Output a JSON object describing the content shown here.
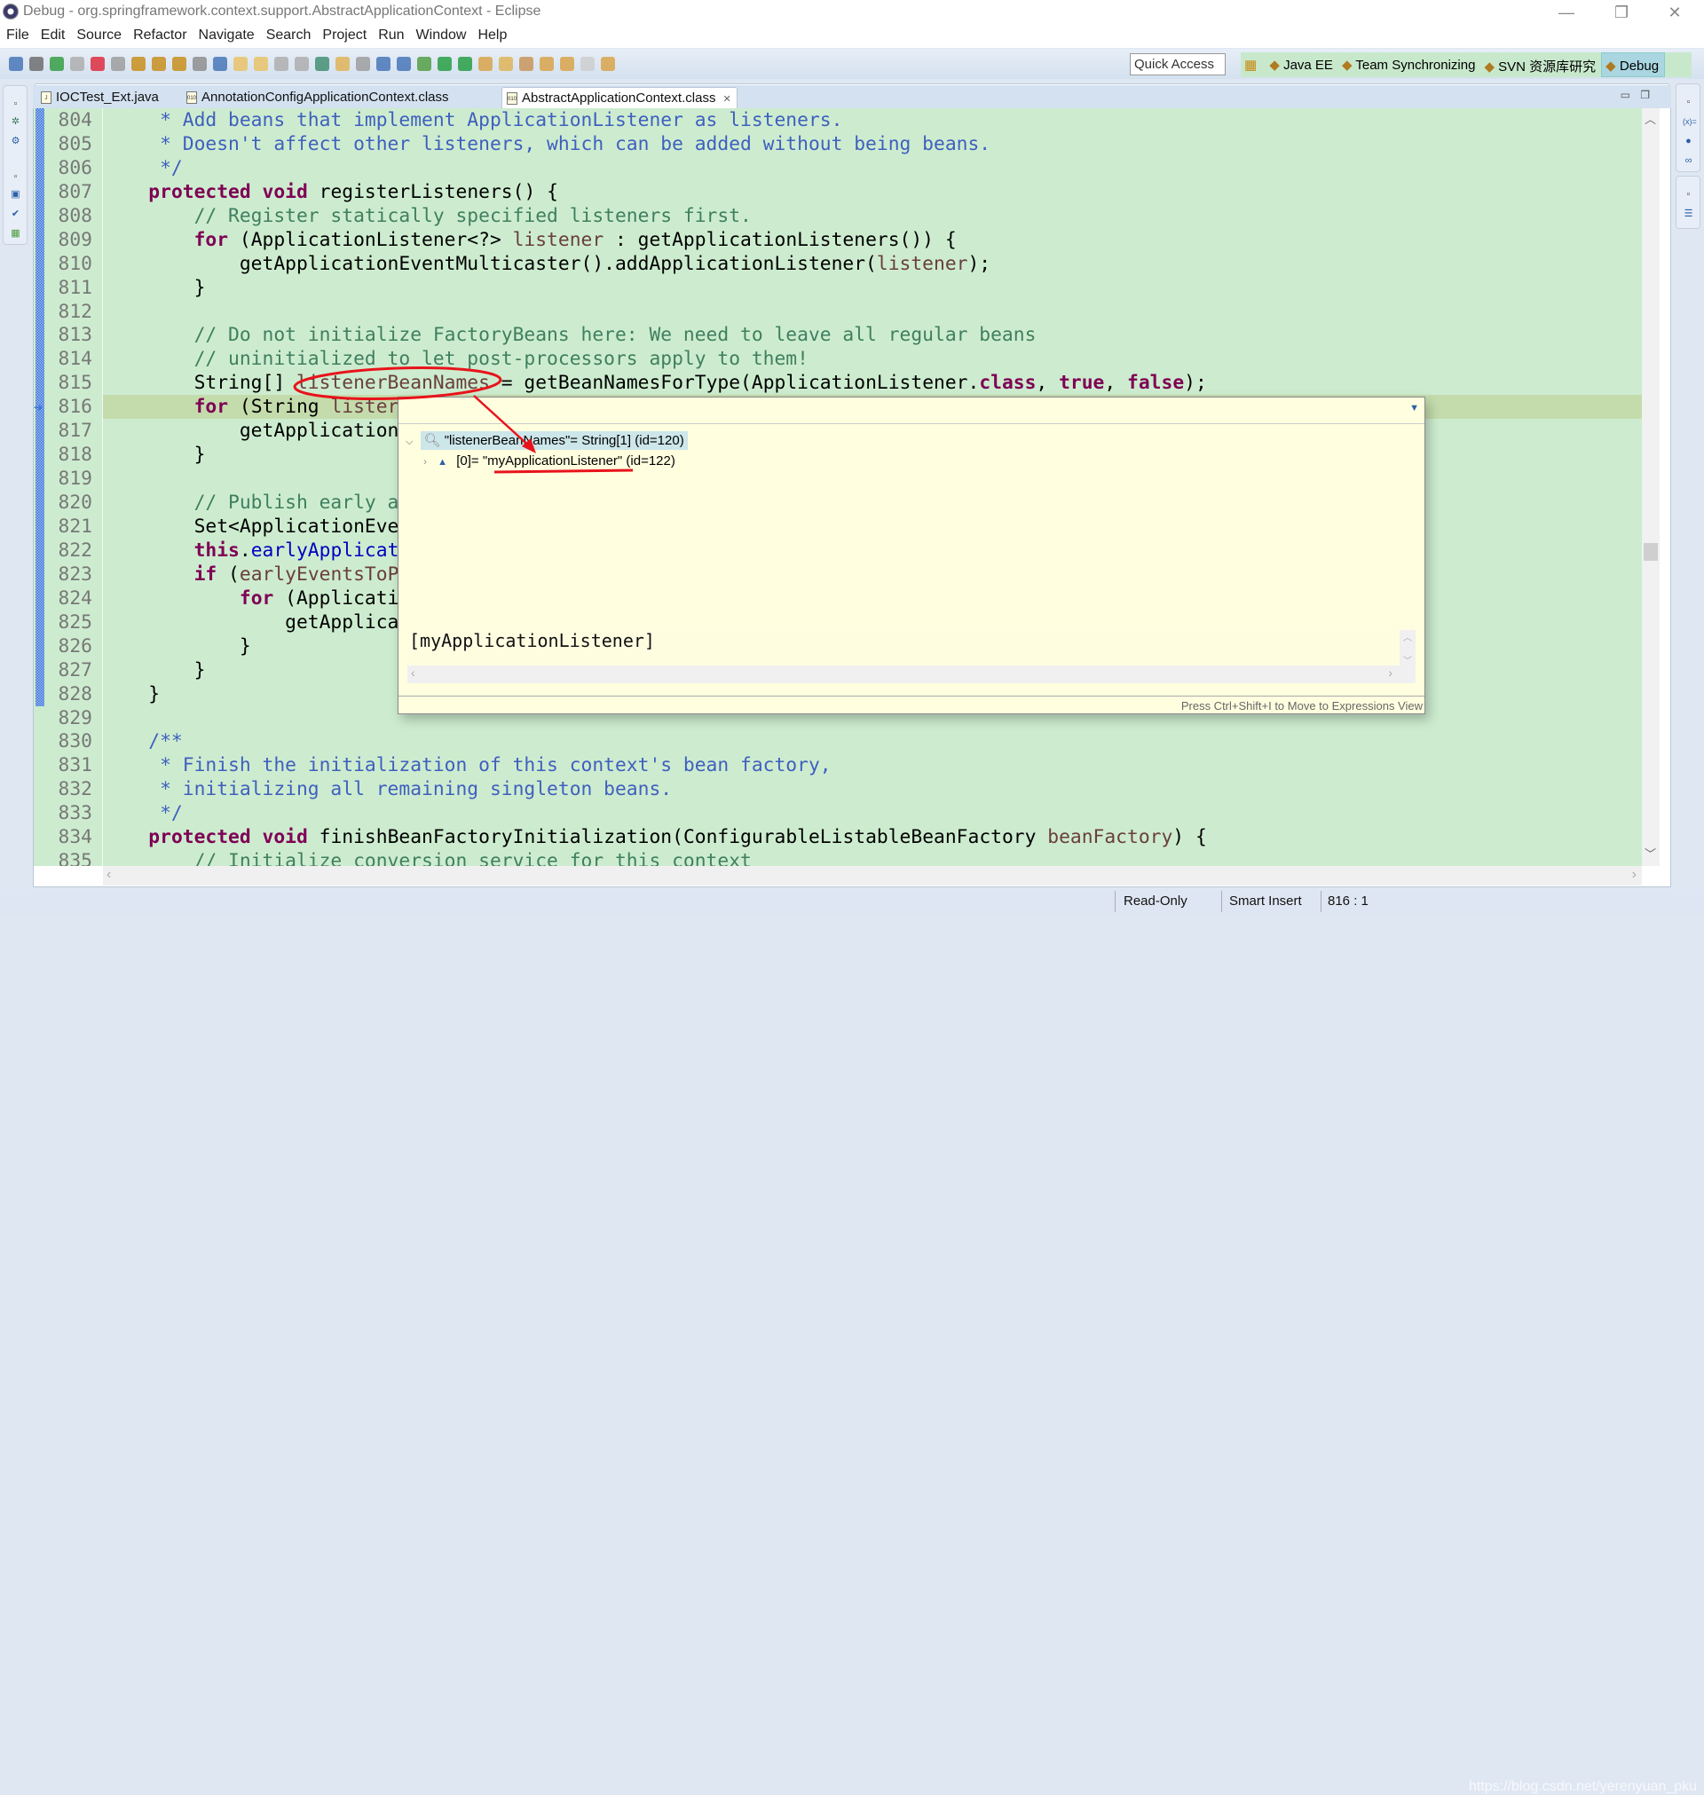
{
  "window": {
    "title": "Debug - org.springframework.context.support.AbstractApplicationContext - Eclipse",
    "minimize": "—",
    "restore": "❐",
    "close": "✕"
  },
  "menu": [
    "File",
    "Edit",
    "Source",
    "Refactor",
    "Navigate",
    "Search",
    "Project",
    "Run",
    "Window",
    "Help"
  ],
  "toolbar": {
    "icons": [
      "debug-view-icon",
      "skip-breakpoints-icon",
      "resume-icon",
      "suspend-icon",
      "terminate-icon",
      "disconnect-icon",
      "step-into-icon",
      "step-over-icon",
      "step-return-icon",
      "drop-to-frame-icon",
      "use-step-filters-icon",
      "new-icon",
      "new-class-icon",
      "save-icon",
      "save-all-icon",
      "open-type-icon",
      "highlight-icon",
      "toggle-mark-icon",
      "block-selection-icon",
      "show-whitespace-icon",
      "debug-run-icon",
      "run-icon",
      "external-tools-icon",
      "open-task-icon",
      "open-folder-icon",
      "search-icon",
      "next-annotation-icon",
      "prev-annotation-icon",
      "back-icon",
      "forward-icon"
    ],
    "colors": [
      "#3f6fb5",
      "#666",
      "#2a9a3a",
      "#aaa",
      "#d23",
      "#999",
      "#c78a10",
      "#c78a10",
      "#c78a10",
      "#888",
      "#3f6fb5",
      "#e8c060",
      "#e8c060",
      "#aaa",
      "#aaa",
      "#3a8a6a",
      "#e0b050",
      "#999",
      "#3f6fb5",
      "#3f6fb5",
      "#4a9a3a",
      "#1c9a3a",
      "#1c9a3a",
      "#d8a040",
      "#e0b050",
      "#c89050",
      "#d8a040",
      "#d8a040",
      "#ccc",
      "#d8a040"
    ],
    "quick_access": "Quick Access"
  },
  "perspectives": [
    {
      "label": "Java EE",
      "icon": "java-ee-icon",
      "selected": false
    },
    {
      "label": "Team Synchronizing",
      "icon": "team-sync-icon",
      "selected": false
    },
    {
      "label": "SVN 资源库研究",
      "icon": "svn-icon",
      "selected": false
    },
    {
      "label": "Debug",
      "icon": "debug-bug-icon",
      "selected": true
    }
  ],
  "tabs": [
    {
      "label": "IOCTest_Ext.java",
      "icon": "java-file-icon"
    },
    {
      "label": "AnnotationConfigApplicationContext.class",
      "icon": "class-file-icon"
    },
    {
      "label": "AbstractApplicationContext.class",
      "icon": "class-file-icon",
      "active": true,
      "close": "✕"
    }
  ],
  "editor": {
    "current_line": 816,
    "lines": [
      {
        "n": "804",
        "t": [
          [
            "     * Add beans that implement ApplicationListener as listeners.",
            "j"
          ]
        ]
      },
      {
        "n": "805",
        "t": [
          [
            "     * Doesn't affect other listeners, which can be added without being beans.",
            "j"
          ]
        ]
      },
      {
        "n": "806",
        "t": [
          [
            "     */",
            "j"
          ]
        ]
      },
      {
        "n": "807",
        "t": [
          [
            "    ",
            "p"
          ],
          [
            "protected",
            "k"
          ],
          [
            " ",
            "p"
          ],
          [
            "void",
            "k"
          ],
          [
            " registerListeners() {",
            "p"
          ]
        ]
      },
      {
        "n": "808",
        "t": [
          [
            "        // Register statically specified listeners first.",
            "c"
          ]
        ]
      },
      {
        "n": "809",
        "t": [
          [
            "        ",
            "p"
          ],
          [
            "for",
            "k"
          ],
          [
            " (ApplicationListener<?> ",
            "p"
          ],
          [
            "listener",
            "v"
          ],
          [
            " : getApplicationListeners()) {",
            "p"
          ]
        ]
      },
      {
        "n": "810",
        "t": [
          [
            "            getApplicationEventMulticaster().addApplicationListener(",
            "p"
          ],
          [
            "listener",
            "v"
          ],
          [
            ");",
            "p"
          ]
        ]
      },
      {
        "n": "811",
        "t": [
          [
            "        }",
            "p"
          ]
        ]
      },
      {
        "n": "812",
        "t": []
      },
      {
        "n": "813",
        "t": [
          [
            "        // Do not initialize FactoryBeans here: We need to leave all regular beans",
            "c"
          ]
        ]
      },
      {
        "n": "814",
        "t": [
          [
            "        // uninitialized to let post-processors apply to them!",
            "c"
          ]
        ]
      },
      {
        "n": "815",
        "t": [
          [
            "        String[] ",
            "p"
          ],
          [
            "listenerBeanNames",
            "v"
          ],
          [
            " = getBeanNamesForType(ApplicationListener.",
            "p"
          ],
          [
            "class",
            "k"
          ],
          [
            ", ",
            "p"
          ],
          [
            "true",
            "k"
          ],
          [
            ", ",
            "p"
          ],
          [
            "false",
            "k"
          ],
          [
            ");",
            "p"
          ]
        ]
      },
      {
        "n": "816",
        "t": [
          [
            "        ",
            "p"
          ],
          [
            "for",
            "k"
          ],
          [
            " (String ",
            "p"
          ],
          [
            "lister",
            "v"
          ]
        ]
      },
      {
        "n": "817",
        "t": [
          [
            "            getApplication",
            "p"
          ]
        ]
      },
      {
        "n": "818",
        "t": [
          [
            "        }",
            "p"
          ]
        ]
      },
      {
        "n": "819",
        "t": []
      },
      {
        "n": "820",
        "t": [
          [
            "        // Publish early a",
            "c"
          ]
        ]
      },
      {
        "n": "821",
        "t": [
          [
            "        Set<ApplicationEve",
            "p"
          ]
        ]
      },
      {
        "n": "822",
        "t": [
          [
            "        ",
            "p"
          ],
          [
            "this",
            "k"
          ],
          [
            ".",
            "p"
          ],
          [
            "earlyApplicat",
            "f"
          ]
        ]
      },
      {
        "n": "823",
        "t": [
          [
            "        ",
            "p"
          ],
          [
            "if",
            "k"
          ],
          [
            " (",
            "p"
          ],
          [
            "earlyEventsToP",
            "v"
          ]
        ]
      },
      {
        "n": "824",
        "t": [
          [
            "            ",
            "p"
          ],
          [
            "for",
            "k"
          ],
          [
            " (Applicati",
            "p"
          ]
        ]
      },
      {
        "n": "825",
        "t": [
          [
            "                getApplica",
            "p"
          ]
        ]
      },
      {
        "n": "826",
        "t": [
          [
            "            }",
            "p"
          ]
        ]
      },
      {
        "n": "827",
        "t": [
          [
            "        }",
            "p"
          ]
        ]
      },
      {
        "n": "828",
        "t": [
          [
            "    }",
            "p"
          ]
        ]
      },
      {
        "n": "829",
        "t": []
      },
      {
        "n": "830",
        "t": [
          [
            "    /**",
            "j"
          ]
        ]
      },
      {
        "n": "831",
        "t": [
          [
            "     * Finish the initialization of this context's bean factory,",
            "j"
          ]
        ]
      },
      {
        "n": "832",
        "t": [
          [
            "     * initializing all remaining singleton beans.",
            "j"
          ]
        ]
      },
      {
        "n": "833",
        "t": [
          [
            "     */",
            "j"
          ]
        ]
      },
      {
        "n": "834",
        "t": [
          [
            "    ",
            "p"
          ],
          [
            "protected",
            "k"
          ],
          [
            " ",
            "p"
          ],
          [
            "void",
            "k"
          ],
          [
            " finishBeanFactoryInitialization(ConfigurableListableBeanFactory ",
            "p"
          ],
          [
            "beanFactory",
            "v"
          ],
          [
            ") {",
            "p"
          ]
        ]
      },
      {
        "n": "835",
        "t": [
          [
            "        // Initialize conversion service for this context",
            "c"
          ]
        ]
      }
    ]
  },
  "inspect_popup": {
    "root": "\"listenerBeanNames\"= String[1]  (id=120)",
    "child": "[0]= \"myApplicationListener\" (id=122)",
    "detail": "[myApplicationListener]",
    "footer": "Press Ctrl+Shift+I to Move to Expressions View"
  },
  "status": {
    "mode": "Read-Only",
    "insert": "Smart Insert",
    "position": "816 : 1"
  },
  "watermark": "https://blog.csdn.net/yerenyuan_pku",
  "annotation_color": "#e8131b"
}
